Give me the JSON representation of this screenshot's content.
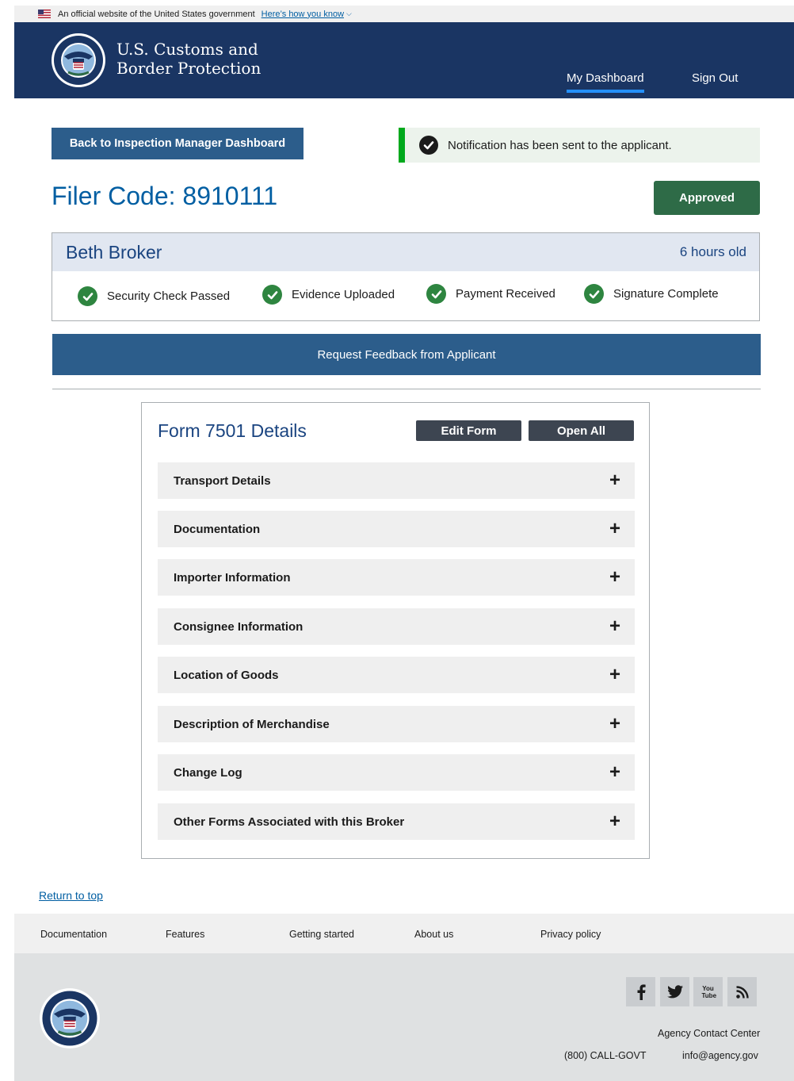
{
  "banner": {
    "text": "An official website of the United States government",
    "link": "Here’s how you know"
  },
  "header": {
    "agency_line1": "U.S. Customs and",
    "agency_line2": "Border Protection",
    "nav": [
      {
        "label": "My Dashboard",
        "active": true
      },
      {
        "label": "Sign Out",
        "active": false
      }
    ]
  },
  "top": {
    "back_label": "Back to Inspection Manager Dashboard",
    "alert_text": "Notification has been sent to the applicant.",
    "filer_code": "Filer Code: 8910111",
    "status_label": "Approved"
  },
  "applicant": {
    "name": "Beth Broker",
    "age": "6 hours old",
    "checks": [
      "Security Check Passed",
      "Evidence Uploaded",
      "Payment Received",
      "Signature Complete"
    ],
    "feedback_label": "Request Feedback from Applicant"
  },
  "form": {
    "title": "Form 7501 Details",
    "edit_label": "Edit Form",
    "open_all_label": "Open All",
    "sections": [
      "Transport Details",
      "Documentation",
      "Importer Information",
      "Consignee Information",
      "Location of Goods",
      "Description of Merchandise",
      "Change Log",
      "Other Forms Associated with this Broker"
    ],
    "expand_symbol": "+"
  },
  "footer": {
    "return_top": "Return to top",
    "links": [
      "Documentation",
      "Features",
      "Getting started",
      "About us",
      "Privacy policy"
    ],
    "social_icons": [
      "facebook-icon",
      "twitter-icon",
      "youtube-icon",
      "rss-icon"
    ],
    "youtube_text": "You Tube",
    "contact_heading": "Agency Contact Center",
    "phone": "(800) CALL-GOVT",
    "email": "info@agency.gov"
  },
  "colors": {
    "header_bg": "#1a3563",
    "primary_button": "#2c5d8b",
    "approved": "#2e6b47",
    "link": "#005ea2",
    "success_bar": "#00a91c"
  }
}
